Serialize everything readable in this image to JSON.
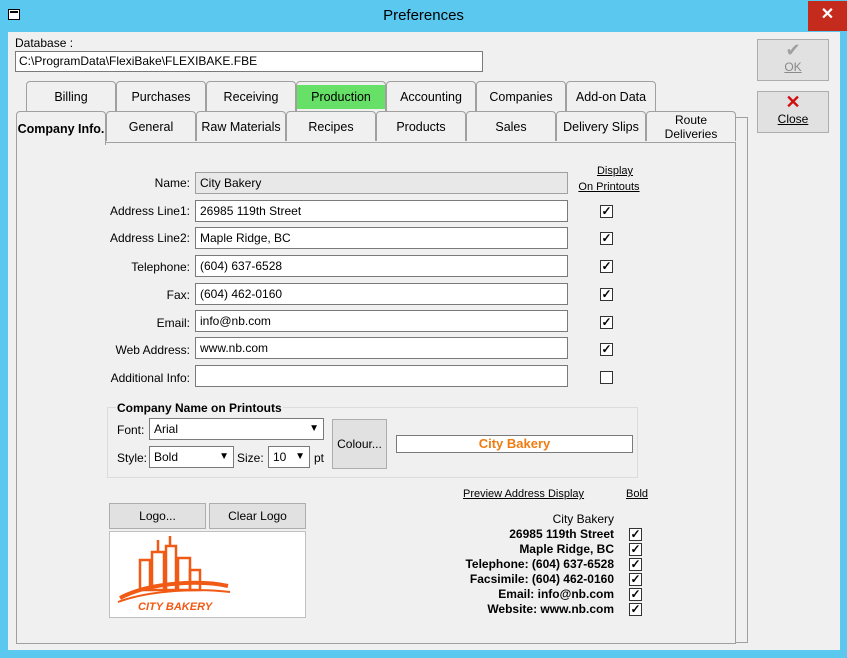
{
  "window": {
    "title": "Preferences",
    "close_glyph": "✕"
  },
  "database": {
    "label": "Database :",
    "path": "C:\\ProgramData\\FlexiBake\\FLEXIBAKE.FBE"
  },
  "buttons": {
    "ok": "OK",
    "close": "Close",
    "logo": "Logo...",
    "clear_logo": "Clear Logo",
    "colour": "Colour..."
  },
  "tabs_row1": [
    "Billing",
    "Purchases",
    "Receiving",
    "Production",
    "Accounting",
    "Companies",
    "Add-on Data"
  ],
  "tabs_row2": [
    "Company Info.",
    "General",
    "Raw Materials",
    "Recipes",
    "Products",
    "Sales",
    "Delivery Slips",
    "Route Deliveries"
  ],
  "display_header": {
    "line1": "Display",
    "line2": "On Printouts"
  },
  "fields": [
    {
      "label": "Name:",
      "value": "City Bakery"
    },
    {
      "label": "Address Line1:",
      "value": "26985 119th Street"
    },
    {
      "label": "Address Line2:",
      "value": "Maple Ridge, BC"
    },
    {
      "label": "Telephone:",
      "value": "(604) 637-6528"
    },
    {
      "label": "Fax:",
      "value": "(604) 462-0160"
    },
    {
      "label": "Email:",
      "value": "info@nb.com"
    },
    {
      "label": "Web Address:",
      "value": "www.nb.com"
    },
    {
      "label": "Additional Info:",
      "value": ""
    }
  ],
  "display_checks": [
    true,
    true,
    true,
    true,
    true,
    true,
    false
  ],
  "printout": {
    "group_title": "Company Name on Printouts",
    "font_label": "Font:",
    "font_value": "Arial",
    "style_label": "Style:",
    "style_value": "Bold",
    "size_label": "Size:",
    "size_value": "10",
    "size_unit": "pt",
    "preview_name": "City Bakery",
    "preview_color": "#f07c10"
  },
  "preview": {
    "header": "Preview Address Display",
    "bold_header": "Bold",
    "lines": [
      "City Bakery",
      "26985 119th Street",
      "Maple Ridge, BC",
      "Telephone: (604) 637-6528",
      "Facsimile: (604) 462-0160",
      "Email: info@nb.com",
      "Website: www.nb.com"
    ],
    "bold_checks": [
      true,
      true,
      true,
      true,
      true,
      true
    ]
  },
  "logo": {
    "text": "CITY BAKERY",
    "color": "#f05a14"
  }
}
